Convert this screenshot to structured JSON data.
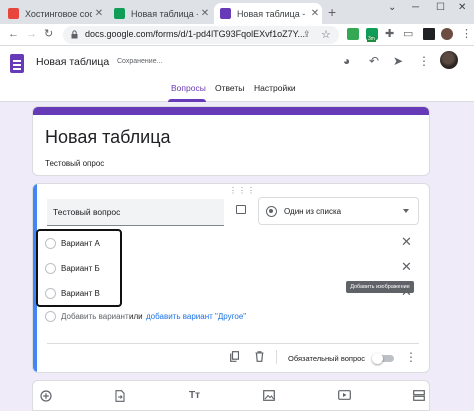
{
  "browser": {
    "tabs": [
      {
        "title": "Хостинговое сообщество"
      },
      {
        "title": "Новая таблица - Google Таблицы"
      },
      {
        "title": "Новая таблица - Google Формы"
      }
    ],
    "url": "docs.google.com/forms/d/1-pd4lTG93FqolEXvf1oZ7Y...",
    "ext_badge": "3m"
  },
  "header": {
    "doc_title": "Новая таблица",
    "save_status": "Сохранение...",
    "tabs": [
      "Вопросы",
      "Ответы",
      "Настройки"
    ],
    "active_tab": 0
  },
  "form": {
    "title": "Новая таблица",
    "description": "Тестовый опрос"
  },
  "question": {
    "text": "Тестовый вопрос",
    "type_label": "Один из списка",
    "options": [
      "Вариант А",
      "Вариант Б",
      "Вариант В"
    ],
    "add_option": "Добавить вариант",
    "or": "или",
    "add_other": "добавить вариант \"Другое\"",
    "tooltip": "Добавить изображение",
    "required_label": "Обязательный вопрос",
    "required": false
  },
  "colors": {
    "forms_purple": "#673ab7",
    "focus_blue": "#4285f4",
    "link_blue": "#1a73e8",
    "background": "#f0ebf8"
  }
}
